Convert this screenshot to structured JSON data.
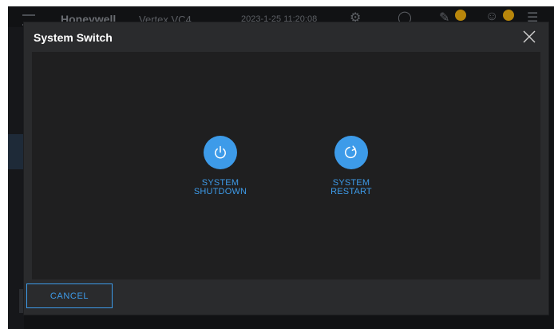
{
  "background_app": {
    "brand": "Honeywell",
    "product": "Vertex VC4",
    "datetime": "2023-1-25 11:20:08"
  },
  "dialog": {
    "title": "System Switch",
    "close_icon": "close-icon",
    "actions": [
      {
        "icon": "power-icon",
        "label_line1": "SYSTEM",
        "label_line2": "SHUTDOWN"
      },
      {
        "icon": "restart-icon",
        "label_line1": "SYSTEM",
        "label_line2": "RESTART"
      }
    ],
    "cancel_label": "CANCEL"
  },
  "colors": {
    "accent": "#3d9be9",
    "dialog_bg": "#2a2b2d",
    "body_bg": "#1f1f20"
  }
}
